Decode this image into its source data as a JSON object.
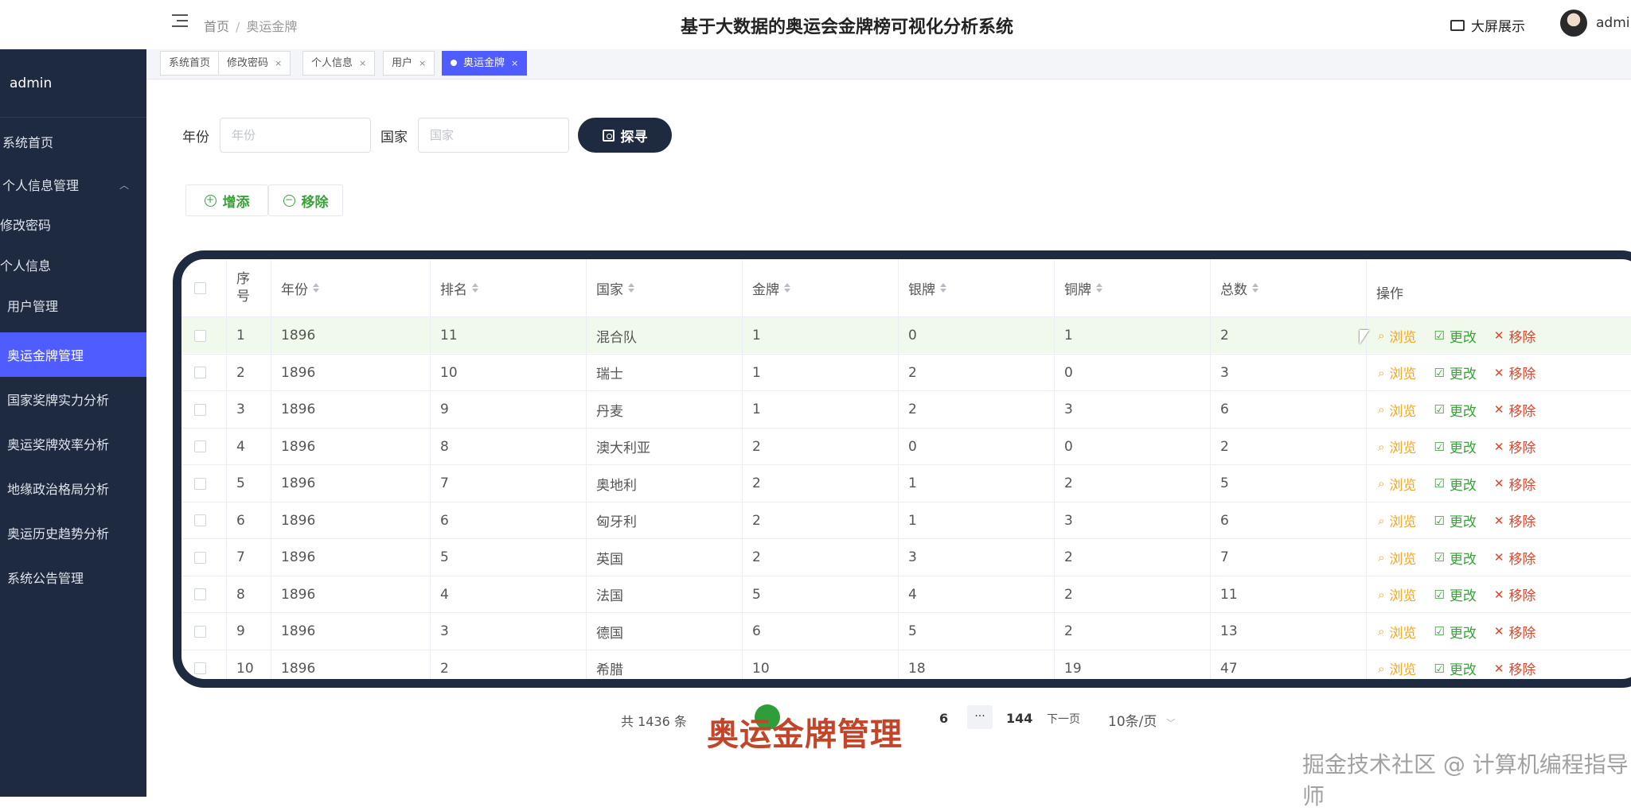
{
  "header": {
    "breadcrumb_home": "首页",
    "breadcrumb_sep": "/",
    "breadcrumb_current": "奥运金牌",
    "system_title": "基于大数据的奥运会金牌榜可视化分析系统",
    "bigscreen_label": "大屏展示",
    "user_name": "admin"
  },
  "sidebar": {
    "user": "admin",
    "items": [
      {
        "label": "系统首页"
      },
      {
        "label": "个人信息管理"
      },
      {
        "label": "修改密码"
      },
      {
        "label": "个人信息"
      },
      {
        "label": "用户管理"
      },
      {
        "label": "奥运金牌管理"
      },
      {
        "label": "国家奖牌实力分析"
      },
      {
        "label": "奥运奖牌效率分析"
      },
      {
        "label": "地缘政治格局分析"
      },
      {
        "label": "奥运历史趋势分析"
      },
      {
        "label": "系统公告管理"
      }
    ]
  },
  "tabs": [
    {
      "label": "系统首页",
      "close": ""
    },
    {
      "label": "修改密码",
      "close": "×"
    },
    {
      "label": "个人信息",
      "close": "×"
    },
    {
      "label": "用户",
      "close": "×"
    },
    {
      "label": "奥运金牌",
      "close": "×"
    }
  ],
  "search": {
    "year_label": "年份",
    "year_placeholder": "年份",
    "country_label": "国家",
    "country_placeholder": "国家",
    "search_button": "探寻"
  },
  "actions": {
    "add_label": "增添",
    "remove_label": "移除"
  },
  "table": {
    "columns": [
      "序号",
      "年份",
      "排名",
      "国家",
      "金牌",
      "银牌",
      "铜牌",
      "总数",
      "操作"
    ],
    "rows": [
      [
        "1",
        "1896",
        "11",
        "混合队",
        "1",
        "0",
        "1",
        "2"
      ],
      [
        "2",
        "1896",
        "10",
        "瑞士",
        "1",
        "2",
        "0",
        "3"
      ],
      [
        "3",
        "1896",
        "9",
        "丹麦",
        "1",
        "2",
        "3",
        "6"
      ],
      [
        "4",
        "1896",
        "8",
        "澳大利亚",
        "2",
        "0",
        "0",
        "2"
      ],
      [
        "5",
        "1896",
        "7",
        "奥地利",
        "2",
        "1",
        "2",
        "5"
      ],
      [
        "6",
        "1896",
        "6",
        "匈牙利",
        "2",
        "1",
        "3",
        "6"
      ],
      [
        "7",
        "1896",
        "5",
        "英国",
        "2",
        "3",
        "2",
        "7"
      ],
      [
        "8",
        "1896",
        "4",
        "法国",
        "5",
        "4",
        "2",
        "11"
      ],
      [
        "9",
        "1896",
        "3",
        "德国",
        "6",
        "5",
        "2",
        "13"
      ],
      [
        "10",
        "1896",
        "2",
        "希腊",
        "10",
        "18",
        "19",
        "47"
      ]
    ],
    "op_view": "浏览",
    "op_edit": "更改",
    "op_delete": "移除"
  },
  "pagination": {
    "total": "共 1436 条",
    "page_6": "6",
    "ellipsis": "···",
    "last_page": "144",
    "next": "下一页",
    "page_size": "10条/页"
  },
  "overlay_title": "奥运金牌管理",
  "watermark": "掘金技术社区 @ 计算机编程指导师",
  "colors": {
    "sidebar_bg": "#1e2a3f",
    "active_blue": "#4f5cff",
    "green": "#3aa03a",
    "orange": "#f5a623",
    "red": "#e0452b"
  }
}
